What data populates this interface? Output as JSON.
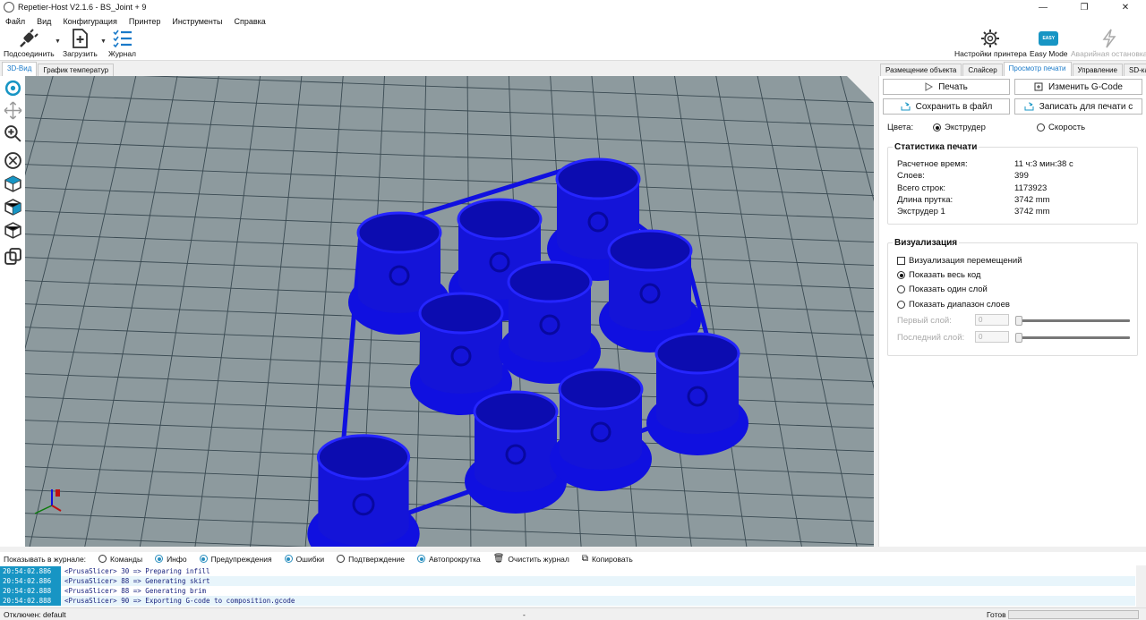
{
  "window": {
    "title": "Repetier-Host V2.1.6 - BS_Joint + 9",
    "minimize": "—",
    "restore": "❐",
    "close": "✕"
  },
  "menu": [
    "Файл",
    "Вид",
    "Конфигурация",
    "Принтер",
    "Инструменты",
    "Справка"
  ],
  "toolbar": {
    "connect": "Подсоединить",
    "load": "Загрузить",
    "log": "Журнал",
    "printer_settings": "Настройки принтера",
    "easy_mode": "Easy Mode",
    "easy_badge": "EASY",
    "emergency_stop": "Аварийная остановка"
  },
  "left_tabs": [
    "3D-Вид",
    "График температур"
  ],
  "right_tabs": [
    "Размещение объекта",
    "Слайсер",
    "Просмотр печати",
    "Управление",
    "SD-карта"
  ],
  "preview": {
    "print_button": "Печать",
    "edit_gcode_button": "Изменить G-Code",
    "save_file_button": "Сохранить в файл",
    "write_sd_button": "Записать для печати с",
    "colors_label": "Цвета:",
    "color_extruder": "Экструдер",
    "color_speed": "Скорость"
  },
  "stats": {
    "title": "Статистика печати",
    "rows": [
      {
        "k": "Расчетное время:",
        "v": "11 ч:3 мин:38 с"
      },
      {
        "k": "Слоев:",
        "v": "399"
      },
      {
        "k": "Всего строк:",
        "v": "1173923"
      },
      {
        "k": "Длина прутка:",
        "v": "3742 mm"
      },
      {
        "k": "Экструдер 1",
        "v": "3742 mm"
      }
    ]
  },
  "visual": {
    "title": "Визуализация",
    "travel": "Визуализация перемещений",
    "show_all": "Показать весь код",
    "show_one": "Показать один слой",
    "show_range": "Показать диапазон слоев",
    "first_layer": "Первый слой:",
    "last_layer": "Последний слой:",
    "first_value": "0",
    "last_value": "0"
  },
  "log": {
    "show_label": "Показывать в журнале:",
    "filters": [
      {
        "label": "Команды",
        "on": false
      },
      {
        "label": "Инфо",
        "on": true
      },
      {
        "label": "Предупреждения",
        "on": true
      },
      {
        "label": "Ошибки",
        "on": true
      },
      {
        "label": "Подтверждение",
        "on": false
      },
      {
        "label": "Автопрокрутка",
        "on": true
      }
    ],
    "clear": "Очистить журнал",
    "copy": "Копировать",
    "lines": [
      {
        "ts": "20:54:02.886",
        "msg": "<PrusaSlicer> 30 => Preparing infill"
      },
      {
        "ts": "20:54:02.886",
        "msg": "<PrusaSlicer> 88 => Generating skirt"
      },
      {
        "ts": "20:54:02.888",
        "msg": "<PrusaSlicer> 88 => Generating brim"
      },
      {
        "ts": "20:54:02.888",
        "msg": "<PrusaSlicer> 90 => Exporting G-code to composition.gcode"
      }
    ]
  },
  "status": {
    "left": "Отключен: default",
    "mid": "-",
    "right": "Готов"
  },
  "colors": {
    "part": "#1010e0",
    "bed": "#8d9a9e",
    "accent": "#1795c4"
  }
}
